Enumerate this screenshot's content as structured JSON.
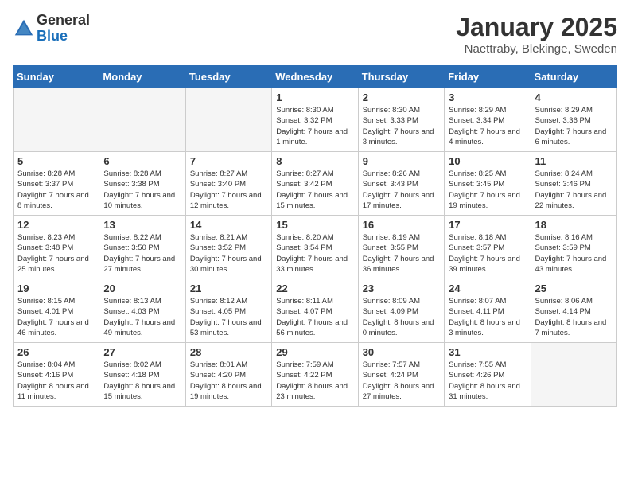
{
  "header": {
    "logo_general": "General",
    "logo_blue": "Blue",
    "title": "January 2025",
    "subtitle": "Naettraby, Blekinge, Sweden"
  },
  "days_of_week": [
    "Sunday",
    "Monday",
    "Tuesday",
    "Wednesday",
    "Thursday",
    "Friday",
    "Saturday"
  ],
  "weeks": [
    [
      {
        "day": "",
        "info": ""
      },
      {
        "day": "",
        "info": ""
      },
      {
        "day": "",
        "info": ""
      },
      {
        "day": "1",
        "info": "Sunrise: 8:30 AM\nSunset: 3:32 PM\nDaylight: 7 hours\nand 1 minute."
      },
      {
        "day": "2",
        "info": "Sunrise: 8:30 AM\nSunset: 3:33 PM\nDaylight: 7 hours\nand 3 minutes."
      },
      {
        "day": "3",
        "info": "Sunrise: 8:29 AM\nSunset: 3:34 PM\nDaylight: 7 hours\nand 4 minutes."
      },
      {
        "day": "4",
        "info": "Sunrise: 8:29 AM\nSunset: 3:36 PM\nDaylight: 7 hours\nand 6 minutes."
      }
    ],
    [
      {
        "day": "5",
        "info": "Sunrise: 8:28 AM\nSunset: 3:37 PM\nDaylight: 7 hours\nand 8 minutes."
      },
      {
        "day": "6",
        "info": "Sunrise: 8:28 AM\nSunset: 3:38 PM\nDaylight: 7 hours\nand 10 minutes."
      },
      {
        "day": "7",
        "info": "Sunrise: 8:27 AM\nSunset: 3:40 PM\nDaylight: 7 hours\nand 12 minutes."
      },
      {
        "day": "8",
        "info": "Sunrise: 8:27 AM\nSunset: 3:42 PM\nDaylight: 7 hours\nand 15 minutes."
      },
      {
        "day": "9",
        "info": "Sunrise: 8:26 AM\nSunset: 3:43 PM\nDaylight: 7 hours\nand 17 minutes."
      },
      {
        "day": "10",
        "info": "Sunrise: 8:25 AM\nSunset: 3:45 PM\nDaylight: 7 hours\nand 19 minutes."
      },
      {
        "day": "11",
        "info": "Sunrise: 8:24 AM\nSunset: 3:46 PM\nDaylight: 7 hours\nand 22 minutes."
      }
    ],
    [
      {
        "day": "12",
        "info": "Sunrise: 8:23 AM\nSunset: 3:48 PM\nDaylight: 7 hours\nand 25 minutes."
      },
      {
        "day": "13",
        "info": "Sunrise: 8:22 AM\nSunset: 3:50 PM\nDaylight: 7 hours\nand 27 minutes."
      },
      {
        "day": "14",
        "info": "Sunrise: 8:21 AM\nSunset: 3:52 PM\nDaylight: 7 hours\nand 30 minutes."
      },
      {
        "day": "15",
        "info": "Sunrise: 8:20 AM\nSunset: 3:54 PM\nDaylight: 7 hours\nand 33 minutes."
      },
      {
        "day": "16",
        "info": "Sunrise: 8:19 AM\nSunset: 3:55 PM\nDaylight: 7 hours\nand 36 minutes."
      },
      {
        "day": "17",
        "info": "Sunrise: 8:18 AM\nSunset: 3:57 PM\nDaylight: 7 hours\nand 39 minutes."
      },
      {
        "day": "18",
        "info": "Sunrise: 8:16 AM\nSunset: 3:59 PM\nDaylight: 7 hours\nand 43 minutes."
      }
    ],
    [
      {
        "day": "19",
        "info": "Sunrise: 8:15 AM\nSunset: 4:01 PM\nDaylight: 7 hours\nand 46 minutes."
      },
      {
        "day": "20",
        "info": "Sunrise: 8:13 AM\nSunset: 4:03 PM\nDaylight: 7 hours\nand 49 minutes."
      },
      {
        "day": "21",
        "info": "Sunrise: 8:12 AM\nSunset: 4:05 PM\nDaylight: 7 hours\nand 53 minutes."
      },
      {
        "day": "22",
        "info": "Sunrise: 8:11 AM\nSunset: 4:07 PM\nDaylight: 7 hours\nand 56 minutes."
      },
      {
        "day": "23",
        "info": "Sunrise: 8:09 AM\nSunset: 4:09 PM\nDaylight: 8 hours\nand 0 minutes."
      },
      {
        "day": "24",
        "info": "Sunrise: 8:07 AM\nSunset: 4:11 PM\nDaylight: 8 hours\nand 3 minutes."
      },
      {
        "day": "25",
        "info": "Sunrise: 8:06 AM\nSunset: 4:14 PM\nDaylight: 8 hours\nand 7 minutes."
      }
    ],
    [
      {
        "day": "26",
        "info": "Sunrise: 8:04 AM\nSunset: 4:16 PM\nDaylight: 8 hours\nand 11 minutes."
      },
      {
        "day": "27",
        "info": "Sunrise: 8:02 AM\nSunset: 4:18 PM\nDaylight: 8 hours\nand 15 minutes."
      },
      {
        "day": "28",
        "info": "Sunrise: 8:01 AM\nSunset: 4:20 PM\nDaylight: 8 hours\nand 19 minutes."
      },
      {
        "day": "29",
        "info": "Sunrise: 7:59 AM\nSunset: 4:22 PM\nDaylight: 8 hours\nand 23 minutes."
      },
      {
        "day": "30",
        "info": "Sunrise: 7:57 AM\nSunset: 4:24 PM\nDaylight: 8 hours\nand 27 minutes."
      },
      {
        "day": "31",
        "info": "Sunrise: 7:55 AM\nSunset: 4:26 PM\nDaylight: 8 hours\nand 31 minutes."
      },
      {
        "day": "",
        "info": ""
      }
    ]
  ]
}
